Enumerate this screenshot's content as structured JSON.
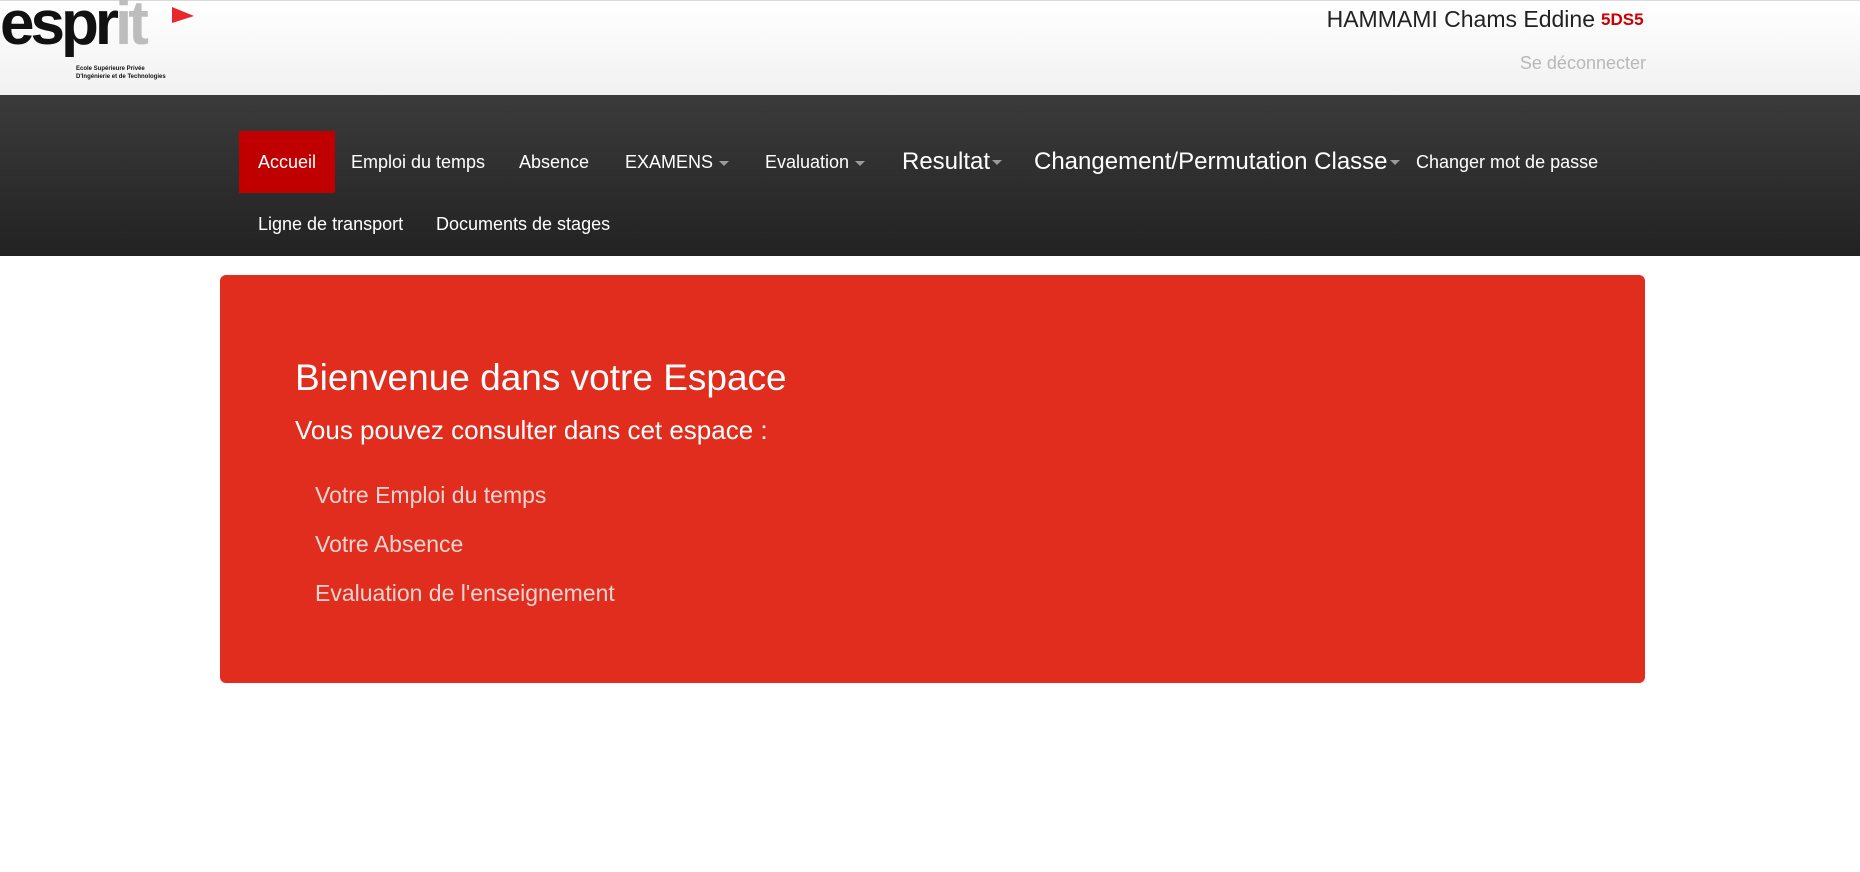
{
  "header": {
    "logo": {
      "wordmark_dark": "espr",
      "wordmark_light": "it",
      "tagline_line1": "Ecole Supérieure Privée",
      "tagline_line2": "D'Ingénierie et de Technologies",
      "flag_color": "#e8292b"
    },
    "user_name": "HAMMAMI Chams Eddine",
    "user_class": "5DS5",
    "logout_label": "Se déconnecter"
  },
  "nav": {
    "items": [
      {
        "label": "Accueil",
        "active": true
      },
      {
        "label": "Emploi du temps"
      },
      {
        "label": "Absence"
      },
      {
        "label": "EXAMENS",
        "dropdown": true
      },
      {
        "label": "Evaluation",
        "dropdown": true
      },
      {
        "label": "Resultat",
        "dropdown": true
      },
      {
        "label": "Changement/Permutation Classe",
        "dropdown": true
      },
      {
        "label": "Changer mot de passe"
      },
      {
        "label": "Ligne de transport"
      },
      {
        "label": "Documents de stages"
      }
    ]
  },
  "welcome": {
    "title": "Bienvenue dans votre Espace",
    "subtitle": "Vous pouvez consulter dans cet espace :",
    "features": [
      "Votre Emploi du temps",
      "Votre Absence",
      "Evaluation de l'enseignement"
    ]
  },
  "colors": {
    "accent_red": "#e12d1d",
    "active_tab": "#c00000",
    "navbar_top": "#3b3b3b",
    "navbar_bottom": "#222222"
  }
}
